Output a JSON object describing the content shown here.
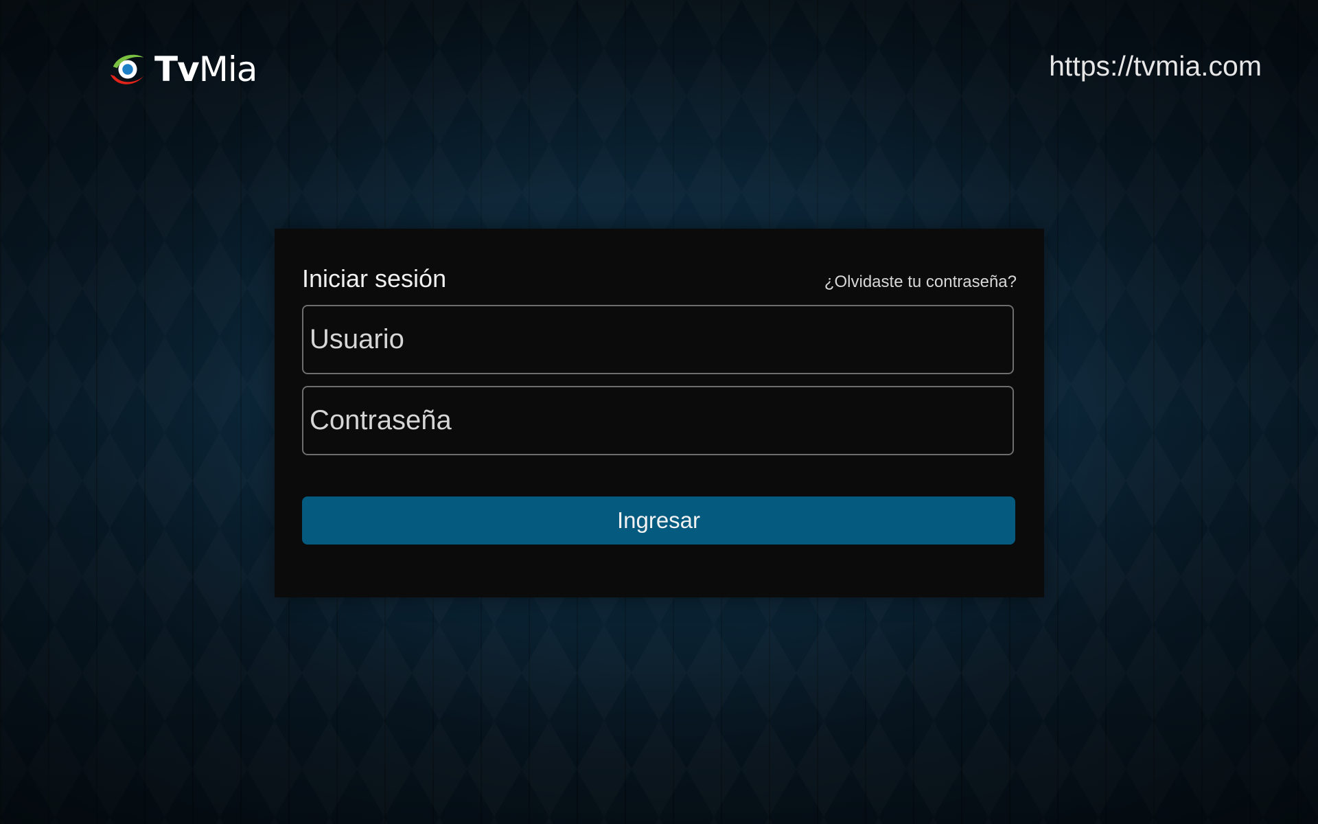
{
  "header": {
    "logo": {
      "icon": "tvmia-eye-logo-icon",
      "name_bold": "Tv",
      "name_regular": "Mia"
    },
    "url": "https://tvmia.com"
  },
  "login": {
    "title": "Iniciar sesión",
    "forgot_password": "¿Olvidaste tu contraseña?",
    "username": {
      "value": "",
      "placeholder": "Usuario"
    },
    "password": {
      "value": "",
      "placeholder": "Contraseña"
    },
    "submit_label": "Ingresar"
  },
  "colors": {
    "background": "#06121b",
    "card": "#0b0b0b",
    "button": "#045a7f",
    "logo_green": "#7cc242",
    "logo_blue": "#1e7fc4",
    "logo_red": "#e2231a"
  }
}
